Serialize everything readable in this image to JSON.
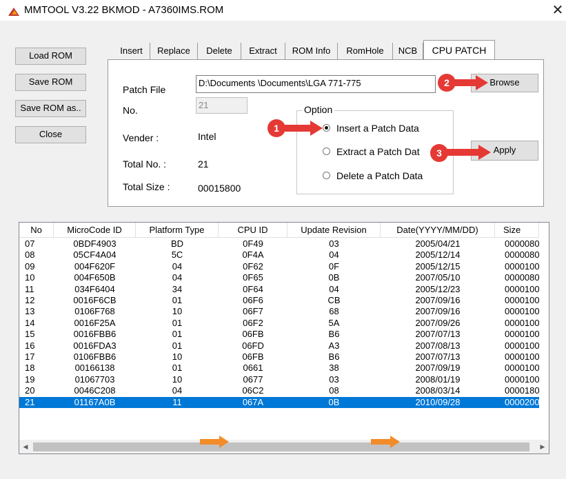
{
  "window": {
    "title": "MMTOOL V3.22 BKMOD - A7360IMS.ROM",
    "close_glyph": "✕"
  },
  "left_buttons": [
    "Load ROM",
    "Save ROM",
    "Save ROM as..",
    "Close"
  ],
  "tabs": [
    "Insert",
    "Replace",
    "Delete",
    "Extract",
    "ROM Info",
    "RomHole",
    "NCB",
    "CPU PATCH"
  ],
  "active_tab": "CPU PATCH",
  "patch": {
    "patch_file_label": "Patch File",
    "patch_file_value": "D:\\Documents                \\Documents\\LGA 771-775",
    "no_label": "No.",
    "no_value": "21",
    "vender_label": "Vender    :",
    "vender_value": "Intel",
    "total_no_label": "Total No.  :",
    "total_no_value": "21",
    "total_size_label": "Total Size  :",
    "total_size_value": "00015800"
  },
  "option": {
    "legend": "Option",
    "radios": [
      "Insert a Patch Data",
      "Extract a Patch Dat",
      "Delete a Patch Data"
    ],
    "selected": "Insert a Patch Data"
  },
  "actions": {
    "browse": "Browse",
    "apply": "Apply"
  },
  "markers": [
    "1",
    "2",
    "3"
  ],
  "table": {
    "columns": [
      "No",
      "MicroCode ID",
      "Platform Type",
      "CPU ID",
      "Update Revision",
      "Date(YYYY/MM/DD)",
      "Size"
    ],
    "rows": [
      [
        "07",
        "0BDF4903",
        "BD",
        "0F49",
        "03",
        "2005/04/21",
        "0000080"
      ],
      [
        "08",
        "05CF4A04",
        "5C",
        "0F4A",
        "04",
        "2005/12/14",
        "0000080"
      ],
      [
        "09",
        "004F620F",
        "04",
        "0F62",
        "0F",
        "2005/12/15",
        "0000100"
      ],
      [
        "10",
        "004F650B",
        "04",
        "0F65",
        "0B",
        "2007/05/10",
        "0000080"
      ],
      [
        "11",
        "034F6404",
        "34",
        "0F64",
        "04",
        "2005/12/23",
        "0000100"
      ],
      [
        "12",
        "0016F6CB",
        "01",
        "06F6",
        "CB",
        "2007/09/16",
        "0000100"
      ],
      [
        "13",
        "0106F768",
        "10",
        "06F7",
        "68",
        "2007/09/16",
        "0000100"
      ],
      [
        "14",
        "0016F25A",
        "01",
        "06F2",
        "5A",
        "2007/09/26",
        "0000100"
      ],
      [
        "15",
        "0016FBB6",
        "01",
        "06FB",
        "B6",
        "2007/07/13",
        "0000100"
      ],
      [
        "16",
        "0016FDA3",
        "01",
        "06FD",
        "A3",
        "2007/08/13",
        "0000100"
      ],
      [
        "17",
        "0106FBB6",
        "10",
        "06FB",
        "B6",
        "2007/07/13",
        "0000100"
      ],
      [
        "18",
        "00166138",
        "01",
        "0661",
        "38",
        "2007/09/19",
        "0000100"
      ],
      [
        "19",
        "01067703",
        "10",
        "0677",
        "03",
        "2008/01/19",
        "0000100"
      ],
      [
        "20",
        "0046C208",
        "04",
        "06C2",
        "08",
        "2008/03/14",
        "0000180"
      ],
      [
        "21",
        "01167A0B",
        "11",
        "067A",
        "0B",
        "2010/09/28",
        "0000200"
      ]
    ],
    "selected_row": "21"
  },
  "scroll_glyphs": {
    "up": "▲",
    "down": "▼",
    "left": "◀",
    "right": "▶"
  },
  "colors": {
    "selection": "#0078d7",
    "marker_red": "#e53935",
    "arrow_orange": "#f28c28"
  }
}
